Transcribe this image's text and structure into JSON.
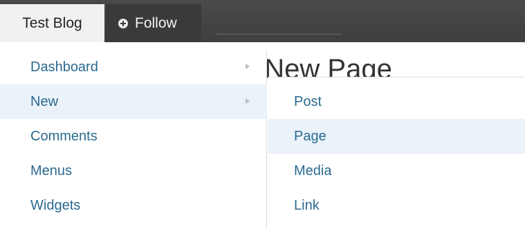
{
  "adminbar": {
    "site_tab_label": "Test Blog",
    "follow_label": "Follow",
    "follow_icon": "plus-circle-icon"
  },
  "page": {
    "heading": "Add New Page"
  },
  "main_menu": {
    "items": [
      {
        "label": "Dashboard",
        "has_submenu": true
      },
      {
        "label": "New",
        "has_submenu": true,
        "active": true
      },
      {
        "label": "Comments"
      },
      {
        "label": "Menus"
      },
      {
        "label": "Widgets"
      }
    ]
  },
  "submenu": {
    "items": [
      {
        "label": "Post"
      },
      {
        "label": "Page",
        "active": true
      },
      {
        "label": "Media"
      },
      {
        "label": "Link"
      }
    ]
  },
  "colors": {
    "adminbar_bg": "#464646",
    "link": "#2b6a8f",
    "highlight": "#eaf2fa"
  }
}
